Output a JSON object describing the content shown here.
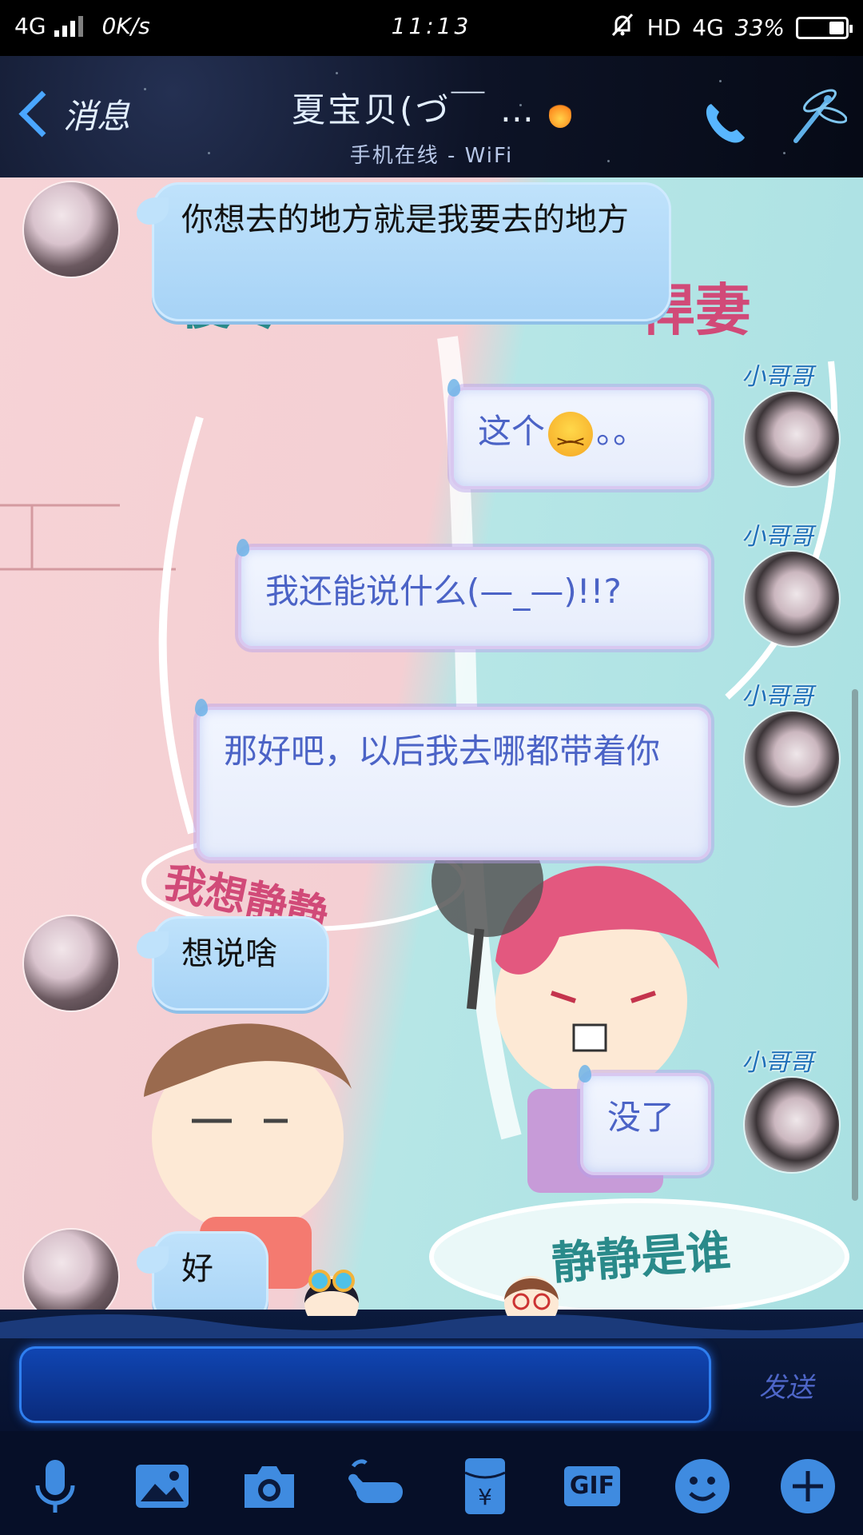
{
  "status_bar": {
    "network": "4G",
    "net_speed": "0K/s",
    "time": "11:13",
    "hd": "HD",
    "network_right": "4G",
    "battery_percent_label": "33%",
    "battery_level": 0.33
  },
  "header": {
    "back_label": "消息",
    "title": "夏宝贝(づ￣ …",
    "subtitle": "手机在线 - WiFi",
    "icons": [
      "chevron-left-icon",
      "flame-icon",
      "phone-icon",
      "dragonfly-icon"
    ]
  },
  "chat": {
    "sender_tag": "小哥哥",
    "background_text": [
      "傻尽",
      "悍妻",
      "我想静静",
      "静静是谁"
    ],
    "messages": [
      {
        "side": "left",
        "text": "你想去的地方就是我要去的地方"
      },
      {
        "side": "right",
        "text_before": "这个",
        "emoji": "persevering-face-icon",
        "text_after": "。。"
      },
      {
        "side": "right",
        "text": "我还能说什么(—_—)!!?"
      },
      {
        "side": "right",
        "text": "那好吧，以后我去哪都带着你"
      },
      {
        "side": "left",
        "text": "想说啥"
      },
      {
        "side": "right",
        "text": "没了"
      },
      {
        "side": "left",
        "text": "好"
      }
    ]
  },
  "input": {
    "value": "",
    "send_label": "发送"
  },
  "toolbar": {
    "gif_label": "GIF",
    "items": [
      "microphone-icon",
      "image-icon",
      "camera-icon",
      "poke-hand-icon",
      "red-packet-icon",
      "gif-icon",
      "emoji-icon",
      "plus-icon"
    ]
  },
  "colors": {
    "accent": "#4aa6ff",
    "bubble_out_text": "#4b63c6",
    "bubble_in": "#bfe2fb",
    "input_bg": "#1046b4"
  }
}
